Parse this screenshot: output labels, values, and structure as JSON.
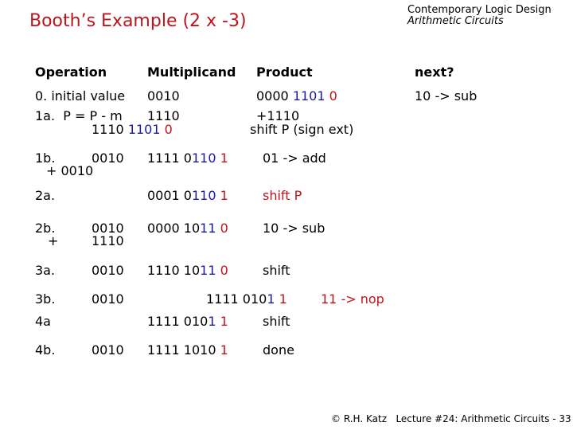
{
  "header": {
    "title": "Booth’s Example (2 x -3)",
    "course": "Contemporary Logic Design",
    "topic": "Arithmetic Circuits"
  },
  "table": {
    "columns": [
      "Operation",
      "Multiplicand",
      "Product",
      "next?"
    ],
    "rows": {
      "r0": {
        "op": "0. initial value",
        "mult": "0010",
        "prod": [
          "0000 ",
          "1101",
          " 0"
        ],
        "next": "10 -> sub"
      },
      "r1a": {
        "op": "1a.  P = P - m",
        "mult": "1110",
        "prod_add": "+1110",
        "prod_note": "shift P (sign ext)",
        "result": [
          "1110 ",
          "1101",
          " 0"
        ]
      },
      "r1b": {
        "op": "1b.",
        "mult": "0010",
        "sub": "+ 0010",
        "prod": [
          "1111 0",
          "110",
          " 1"
        ],
        "next": "01 -> add"
      },
      "r2a": {
        "op": "2a.",
        "prod": [
          "0001 0",
          "110",
          " 1"
        ],
        "next": "shift P"
      },
      "r2b": {
        "op": "2b.",
        "op2": "+",
        "mult": "0010",
        "mult2": "1110",
        "prod": [
          "0000 10",
          "11",
          " 0"
        ],
        "next": "10 -> sub"
      },
      "r3a": {
        "op": "3a.",
        "mult": "0010",
        "prod": [
          "1110 10",
          "11",
          " 0"
        ],
        "next": "shift"
      },
      "r3b": {
        "op": "3b.",
        "mult": "0010",
        "prod": [
          "1111 010",
          "1",
          " 1"
        ],
        "next": "11 -> nop"
      },
      "r4a": {
        "op": "4a",
        "prod": [
          "1111 010",
          "1",
          " 1"
        ],
        "next": "shift"
      },
      "r4b": {
        "op": "4b.",
        "mult": "0010",
        "prod": [
          "1111 1010",
          " 1"
        ],
        "next": "done"
      }
    }
  },
  "footer": "© R.H. Katz   Lecture #24: Arithmetic Circuits - 33"
}
